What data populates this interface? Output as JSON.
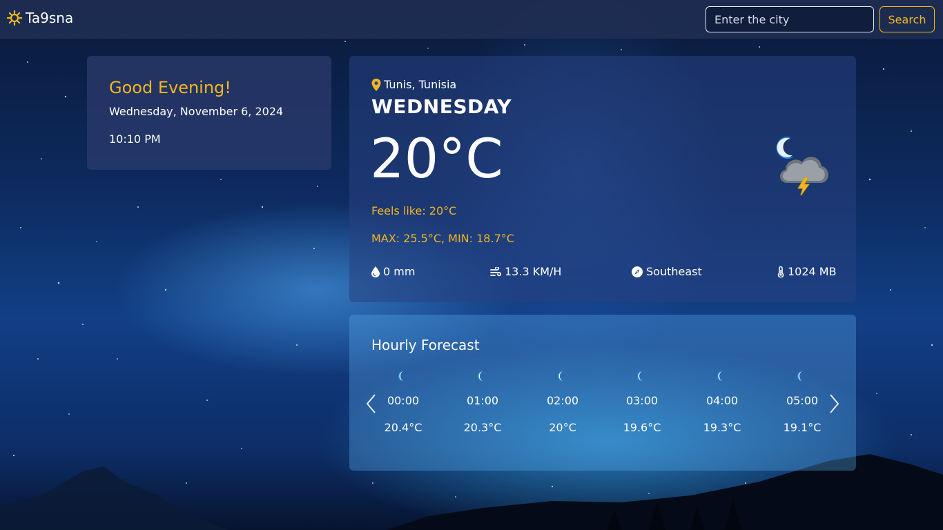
{
  "navbar": {
    "brand": "Ta9sna",
    "brand_icon": "sun-icon",
    "search_placeholder": "Enter the city",
    "search_button": "Search"
  },
  "greeting_card": {
    "greeting": "Good Evening!",
    "date": "Wednesday, November 6, 2024",
    "time": "10:10 PM"
  },
  "current": {
    "location": "Tunis, Tunisia",
    "location_icon": "map-pin-icon",
    "day": "WEDNESDAY",
    "temperature": "20°C",
    "condition_icon": "night-thunderstorm-icon",
    "feels_like": "Feels like: 20°C",
    "max_min": "MAX: 25.5°C, MIN: 18.7°C",
    "stats": [
      {
        "icon": "droplet-icon",
        "value": "0 mm"
      },
      {
        "icon": "wind-icon",
        "value": "13.3 KM/H"
      },
      {
        "icon": "compass-icon",
        "value": "Southeast"
      },
      {
        "icon": "thermometer-icon",
        "value": "1024 MB"
      }
    ]
  },
  "hourly": {
    "title": "Hourly Forecast",
    "items": [
      {
        "time": "00:00",
        "temp": "20.4°C",
        "icon": "moon-icon"
      },
      {
        "time": "01:00",
        "temp": "20.3°C",
        "icon": "moon-icon"
      },
      {
        "time": "02:00",
        "temp": "20°C",
        "icon": "moon-icon"
      },
      {
        "time": "03:00",
        "temp": "19.6°C",
        "icon": "moon-icon"
      },
      {
        "time": "04:00",
        "temp": "19.3°C",
        "icon": "moon-icon"
      },
      {
        "time": "05:00",
        "temp": "19.1°C",
        "icon": "moon-icon"
      }
    ]
  },
  "colors": {
    "accent": "#f2b620",
    "navbar": "#213054",
    "text": "#ffffff"
  }
}
